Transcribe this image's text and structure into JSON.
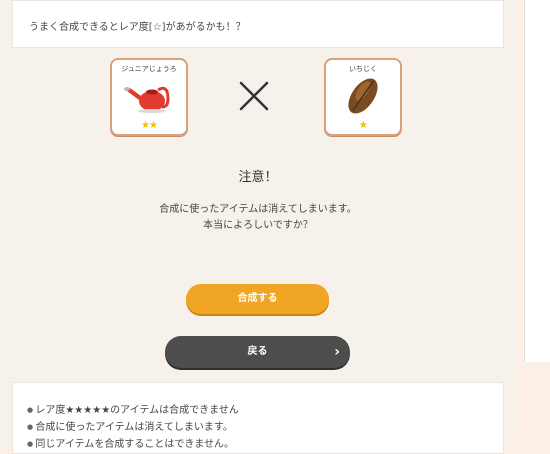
{
  "hint": {
    "text": "うまく合成できるとレア度[☆]があがるかも！？"
  },
  "items": [
    {
      "name": "ジュニアじょうろ",
      "stars": "★★",
      "icon": "watering-can-icon"
    },
    {
      "name": "いちじく",
      "stars": "★",
      "icon": "seed-icon"
    }
  ],
  "combine_symbol_icon": "times-icon",
  "warning": {
    "title": "注意！",
    "line1": "合成に使ったアイテムは消えてしまいます。",
    "line2": "本当によろしいですか？"
  },
  "buttons": {
    "combine_label": "合成する",
    "back_label": "戻る",
    "back_arrow": "›"
  },
  "notes": [
    "レア度★★★★★のアイテムは合成できません",
    "合成に使ったアイテムは消えてしまいます。",
    "同じアイテムを合成することはできません。"
  ],
  "colors": {
    "accent": "#f0a624",
    "back_button": "#4d4d4d",
    "item_border": "#d9a27e",
    "star": "#f2c200"
  }
}
